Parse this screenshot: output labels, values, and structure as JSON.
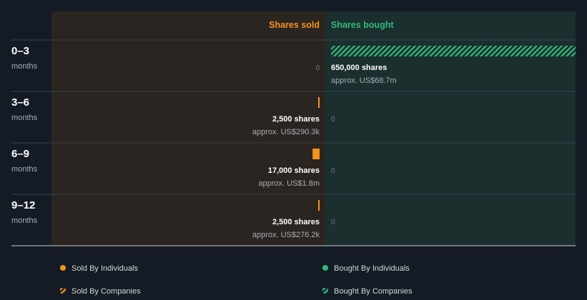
{
  "colors": {
    "background": "#151b24",
    "sold_panel": "#2a2520",
    "bought_panel": "#1b2f2f",
    "sold_accent": "#f7931a",
    "bought_accent": "#2ebd7a",
    "muted_text": "#a7adb5",
    "zero_text": "#6f7780",
    "divider": "#3a4048",
    "axis_line": "#c7ccd1"
  },
  "chart_data": {
    "type": "bar",
    "orientation": "horizontal-diverging",
    "unit": "shares",
    "headers": {
      "sold": "Shares sold",
      "bought": "Shares bought"
    },
    "categories": [
      {
        "label": "0–3",
        "sublabel": "months"
      },
      {
        "label": "3–6",
        "sublabel": "months"
      },
      {
        "label": "6–9",
        "sublabel": "months"
      },
      {
        "label": "9–12",
        "sublabel": "months"
      }
    ],
    "series": [
      {
        "name": "Sold By Individuals",
        "side": "sold",
        "pattern": "solid",
        "values": [
          0,
          2500,
          17000,
          2500
        ],
        "value_labels": [
          "",
          "2,500 shares",
          "17,000 shares",
          "2,500 shares"
        ],
        "approx_labels": [
          "",
          "approx. US$290.3k",
          "approx. US$1.8m",
          "approx. US$276.2k"
        ]
      },
      {
        "name": "Sold By Companies",
        "side": "sold",
        "pattern": "hatched",
        "values": [
          0,
          0,
          0,
          0
        ]
      },
      {
        "name": "Bought By Individuals",
        "side": "bought",
        "pattern": "solid",
        "values": [
          0,
          0,
          0,
          0
        ]
      },
      {
        "name": "Bought By Companies",
        "side": "bought",
        "pattern": "hatched",
        "values": [
          650000,
          0,
          0,
          0
        ],
        "value_labels": [
          "650,000 shares",
          "",
          "",
          ""
        ],
        "approx_labels": [
          "approx. US$68.7m",
          "",
          "",
          ""
        ]
      }
    ],
    "zero_labels": {
      "sold": [
        "0",
        "",
        "",
        ""
      ],
      "bought": [
        "",
        "0",
        "0",
        "0"
      ]
    },
    "legend": {
      "placement": "bottom",
      "items": [
        {
          "label": "Sold By Individuals",
          "marker": "dot",
          "color": "#f7931a"
        },
        {
          "label": "Bought By Individuals",
          "marker": "dot",
          "color": "#2ebd7a"
        },
        {
          "label": "Sold By Companies",
          "marker": "hatch",
          "color": "#f7931a"
        },
        {
          "label": "Bought By Companies",
          "marker": "hatch",
          "color": "#2ebd7a"
        }
      ]
    }
  }
}
